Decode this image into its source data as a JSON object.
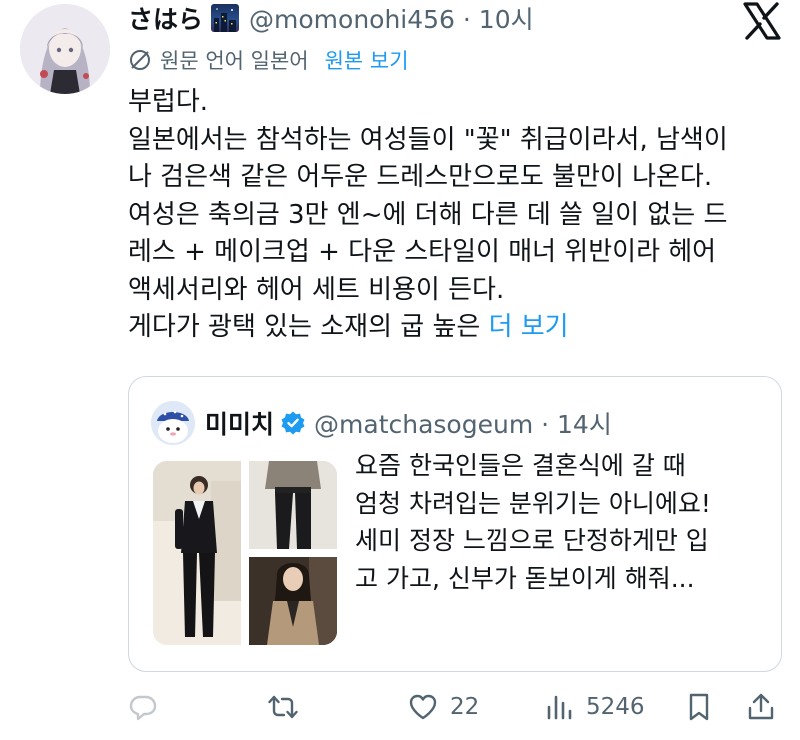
{
  "tweet": {
    "display_name": "さはら",
    "name_emoji": "night-city-emoji",
    "handle_time": "@momonohi456 · 10시",
    "translation_note": "원문 언어 일본어",
    "show_original": "원본 보기",
    "body_lines": [
      "부럽다.",
      "일본에서는 참석하는 여성들이 \"꽃\" 취급이라서, 남색이",
      "나 검은색 같은 어두운 드레스만으로도 불만이 나온다.",
      "여성은 축의금 3만 엔~에 더해 다른 데 쓸 일이 없는 드",
      "레스 + 메이크업 + 다운 스타일이 매너 위반이라 헤어",
      "액세서리와 헤어 세트 비용이 든다."
    ],
    "body_last_line": "게다가 광택 있는 소재의 굽 높은 ",
    "more": "더 보기"
  },
  "quote": {
    "display_name": "미미치",
    "verified": true,
    "handle_time": "@matchasogeum · 14시",
    "text_lines": [
      "요즘 한국인들은 결혼식에 갈 때",
      "엄청 차려입는 분위기는 아니에요!",
      "세미 정장 느낌으로 단정하게만 입",
      "고 가고, 신부가 돋보이게 해줘..."
    ]
  },
  "actions": {
    "reply_count": "",
    "retweet_count": "",
    "like_count": "22",
    "views_count": "5246"
  },
  "icons": {
    "brand": "x-logo-icon",
    "translate": "globe-slash-icon",
    "reply": "reply-icon",
    "retweet": "retweet-icon",
    "like": "heart-icon",
    "views": "views-icon",
    "bookmark": "bookmark-icon",
    "share": "share-icon"
  },
  "colors": {
    "text": "#0f1419",
    "muted": "#536471",
    "link": "#1d9bf0",
    "border": "#cfd9de"
  }
}
